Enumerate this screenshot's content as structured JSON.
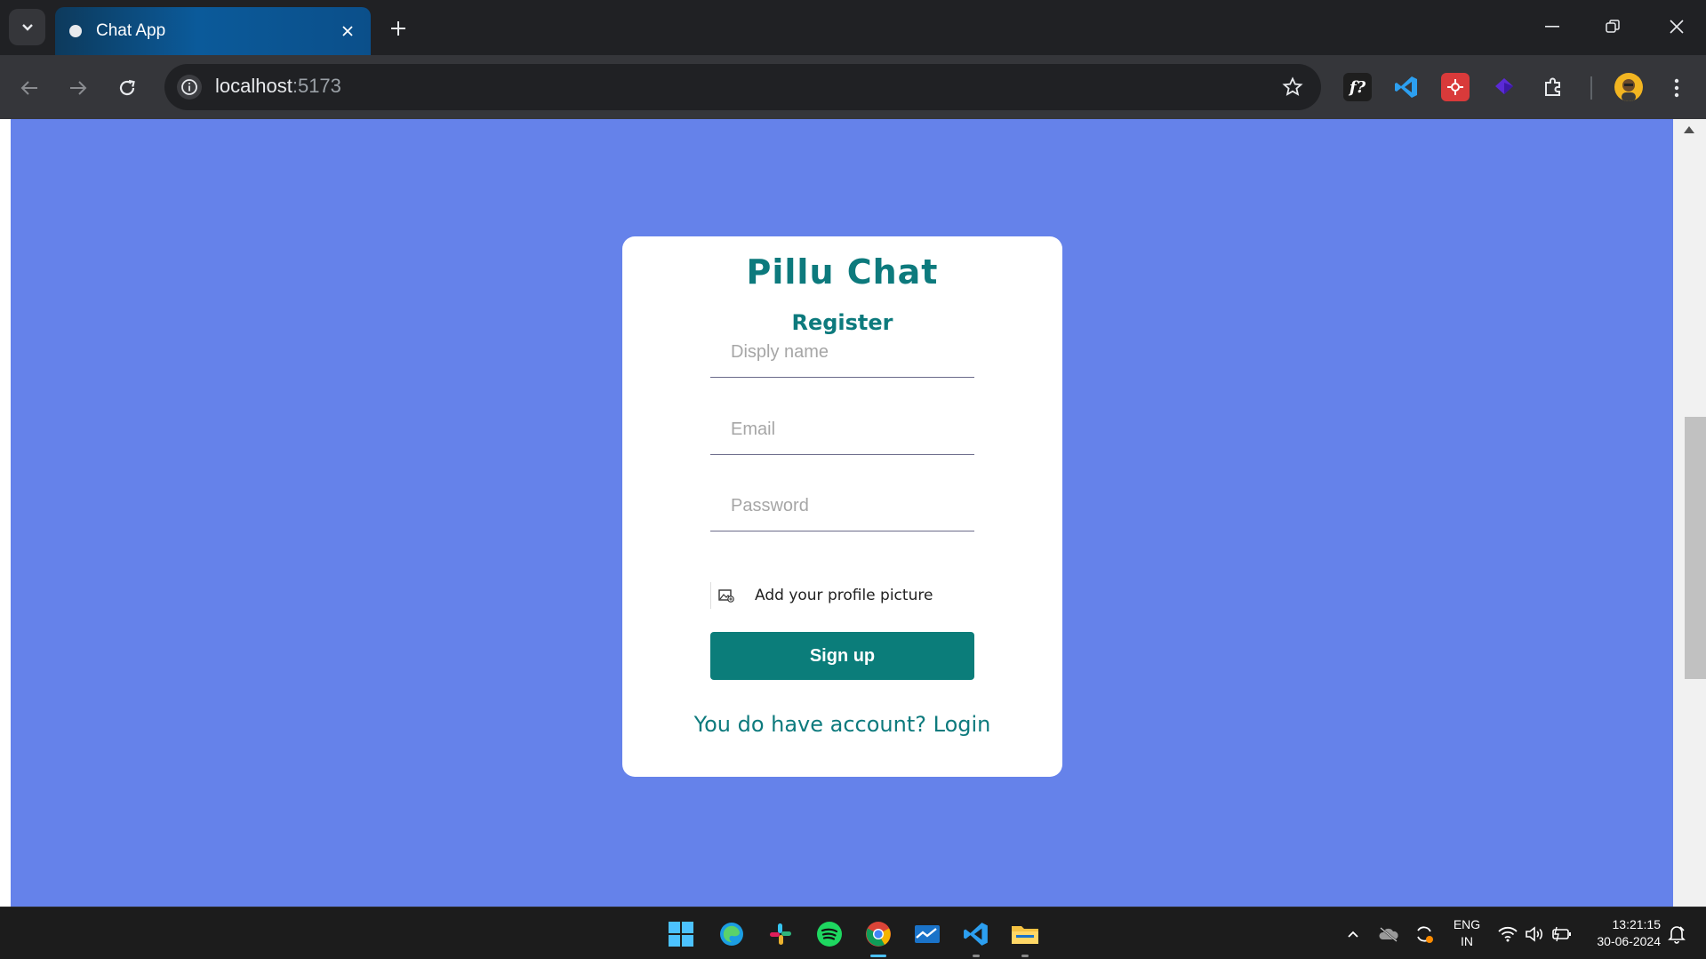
{
  "browser": {
    "tab_title": "Chat App",
    "url_host": "localhost",
    "url_port": ":5173",
    "extensions": [
      "font-detector-icon",
      "vscode-icon",
      "devtools-extension-icon",
      "purple-cube-icon",
      "extensions-puzzle-icon"
    ]
  },
  "app": {
    "logo": "Pillu Chat",
    "subtitle": "Register",
    "fields": {
      "display_name_placeholder": "Disply name",
      "email_placeholder": "Email",
      "password_placeholder": "Password"
    },
    "avatar_label": "Add your profile picture",
    "submit_label": "Sign up",
    "switch_text": "You do have account? Login"
  },
  "colors": {
    "page_bg": "#6582ea",
    "brand": "#0d7a7d",
    "button": "#0b7d7a"
  },
  "taskbar": {
    "apps": [
      "windows-start-icon",
      "edge-icon",
      "slack-icon",
      "spotify-icon",
      "chrome-icon",
      "mail-icon",
      "vscode-icon",
      "file-explorer-icon"
    ],
    "lang_top": "ENG",
    "lang_bottom": "IN",
    "time": "13:21:15",
    "date": "30-06-2024"
  }
}
